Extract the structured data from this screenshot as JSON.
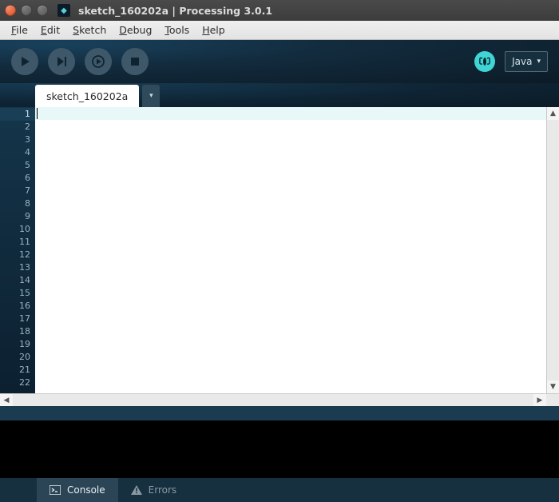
{
  "titlebar": {
    "title": "sketch_160202a | Processing 3.0.1"
  },
  "menubar": {
    "items": [
      {
        "pre": "",
        "key": "F",
        "post": "ile"
      },
      {
        "pre": "",
        "key": "E",
        "post": "dit"
      },
      {
        "pre": "",
        "key": "S",
        "post": "ketch"
      },
      {
        "pre": "",
        "key": "D",
        "post": "ebug"
      },
      {
        "pre": "",
        "key": "T",
        "post": "ools"
      },
      {
        "pre": "",
        "key": "H",
        "post": "elp"
      }
    ]
  },
  "toolbar": {
    "run_icon": "run-icon",
    "present_icon": "present-icon",
    "debug_icon": "debug-run-icon",
    "stop_icon": "stop-icon",
    "butterfly_icon": "debug-butterfly-icon",
    "mode_label": "Java",
    "mode_arrow": "▾"
  },
  "tabs": {
    "active": "sketch_160202a",
    "dropdown_arrow": "▾"
  },
  "editor": {
    "line_numbers": [
      "1",
      "2",
      "3",
      "4",
      "5",
      "6",
      "7",
      "8",
      "9",
      "10",
      "11",
      "12",
      "13",
      "14",
      "15",
      "16",
      "17",
      "18",
      "19",
      "20",
      "21",
      "22"
    ],
    "active_line_index": 0,
    "content": ""
  },
  "bottom_tabs": {
    "console_label": "Console",
    "errors_label": "Errors"
  }
}
